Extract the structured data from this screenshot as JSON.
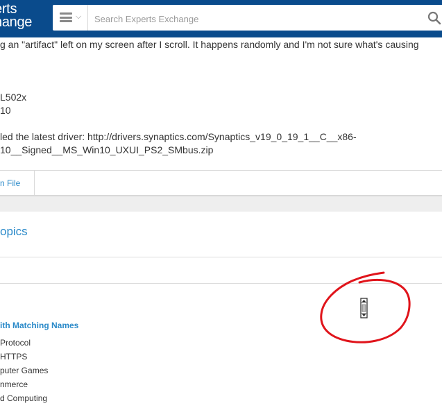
{
  "header": {
    "logo_line1": "erts",
    "logo_line2": "hange",
    "search_placeholder": "Search Experts Exchange"
  },
  "question": {
    "line1": "g an \"artifact\" left on my screen after I scroll.  It happens randomly and I'm not sure what's causing",
    "spec1": "L502x",
    "spec2": "10",
    "driver_line1": "led the latest driver: http://drivers.synaptics.com/Synaptics_v19_0_19_1__C__x86-",
    "driver_line2": "10__Signed__MS_Win10_UXUI_PS2_SMbus.zip"
  },
  "attachment": {
    "label": "n File"
  },
  "topics": {
    "title": "opics",
    "matching_title": "ith Matching Names",
    "items": [
      "Protocol",
      "HTTPS",
      "puter Games",
      "nmerce",
      "d Computing"
    ]
  },
  "colors": {
    "header_bg": "#0a4b8c",
    "link": "#2b8ac9",
    "annotation": "#e0141b"
  }
}
